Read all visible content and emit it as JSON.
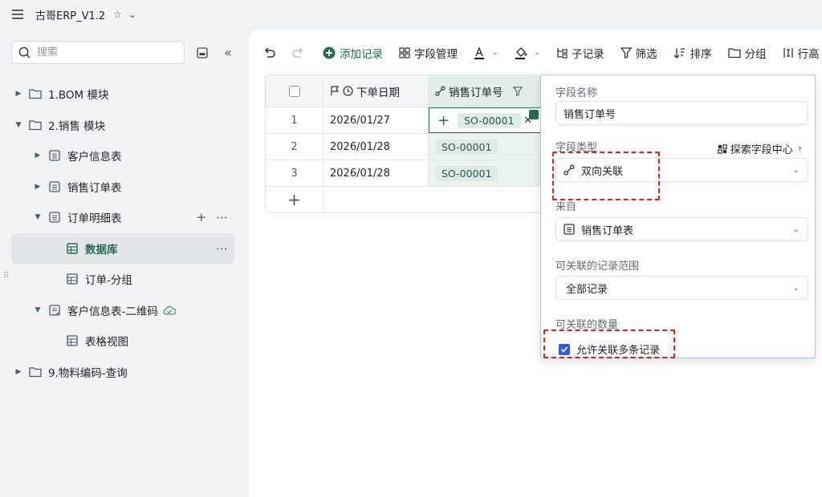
{
  "app": {
    "title": "古哥ERP_V1.2"
  },
  "sidebar": {
    "search_placeholder": "搜索",
    "tree": [
      {
        "label": "1.BOM 模块"
      },
      {
        "label": "2.销售 模块"
      },
      {
        "label": "客户信息表"
      },
      {
        "label": "销售订单表"
      },
      {
        "label": "订单明细表"
      },
      {
        "label": "数据库"
      },
      {
        "label": "订单-分组"
      },
      {
        "label": "客户信息表-二维码"
      },
      {
        "label": "表格视图"
      },
      {
        "label": "9.物料编码-查询"
      }
    ]
  },
  "toolbar": {
    "add_record": "添加记录",
    "field_manage": "字段管理",
    "sub_record": "子记录",
    "filter": "筛选",
    "sort": "排序",
    "group": "分组",
    "row_height": "行高"
  },
  "grid": {
    "columns": [
      "下单日期",
      "销售订单号"
    ],
    "rows": [
      {
        "num": "1",
        "date": "2026/01/27",
        "order": "SO-00001"
      },
      {
        "num": "2",
        "date": "2026/01/28",
        "order": "SO-00001"
      },
      {
        "num": "3",
        "date": "2026/01/28",
        "order": "SO-00001"
      }
    ],
    "add_row": "+"
  },
  "panel": {
    "field_name_label": "字段名称",
    "field_name_value": "销售订单号",
    "field_type_label": "字段类型",
    "explore": "探索字段中心",
    "field_type_value": "双向关联",
    "source_label": "来自",
    "source_value": "销售订单表",
    "range_label": "可关联的记录范围",
    "range_value": "全部记录",
    "count_label": "可关联的数量",
    "allow_multi": "允许关联多条记录"
  },
  "colors": {
    "accent": "#2b6a53",
    "checkbox": "#2c5fd6",
    "annotation": "#e02020"
  }
}
